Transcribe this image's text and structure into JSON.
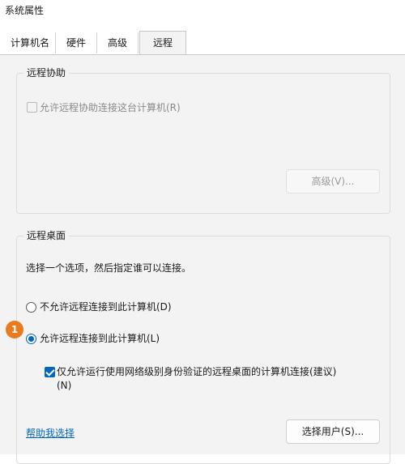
{
  "window": {
    "title": "系统属性"
  },
  "tabs": [
    {
      "label": "计算机名"
    },
    {
      "label": "硬件"
    },
    {
      "label": "高级"
    },
    {
      "label": "远程"
    }
  ],
  "remote_assistance": {
    "group_title": "远程协助",
    "allow_checkbox_label": "允许远程协助连接这台计算机(R)",
    "allow_checked": false,
    "advanced_button": "高级(V)..."
  },
  "remote_desktop": {
    "group_title": "远程桌面",
    "instruction": "选择一个选项，然后指定谁可以连接。",
    "option_deny": "不允许远程连接到此计算机(D)",
    "option_allow": "允许远程连接到此计算机(L)",
    "selected": "option_allow",
    "nla_label_line1": "仅允许运行使用网络级别身份验证的远程桌面的计算机连接(建议)",
    "nla_label_line2": "(N)",
    "nla_checked": true,
    "help_link": "帮助我选择",
    "select_users_button": "选择用户(S)..."
  },
  "annotation": {
    "step_number": "1",
    "color": "#ea7a1e"
  },
  "colors": {
    "accent": "#0067c0",
    "panel_bg": "#f3f3f3"
  }
}
